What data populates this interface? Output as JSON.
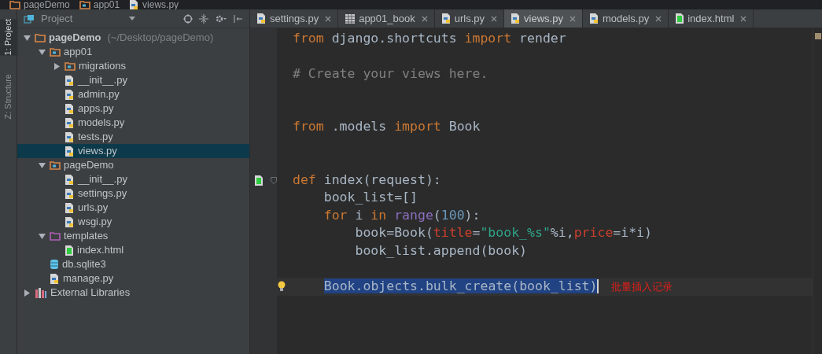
{
  "breadcrumbs": [
    {
      "label": "pageDemo",
      "kind": "folder"
    },
    {
      "label": "app01",
      "kind": "module"
    },
    {
      "label": "views.py",
      "kind": "python"
    }
  ],
  "tool_strip": [
    {
      "label": "1: Project",
      "selected": true
    },
    {
      "label": "Z: Structure",
      "selected": false
    }
  ],
  "project_panel": {
    "title": "Project",
    "tree": [
      {
        "label": "pageDemo",
        "path": "(~/Desktop/pageDemo)",
        "kind": "folder",
        "expanded": true,
        "selected": false,
        "children": [
          {
            "label": "app01",
            "kind": "module",
            "expanded": true,
            "selected": false,
            "children": [
              {
                "label": "migrations",
                "kind": "module",
                "expanded": false,
                "selected": false
              },
              {
                "label": "__init__.py",
                "kind": "python",
                "selected": false
              },
              {
                "label": "admin.py",
                "kind": "python",
                "selected": false
              },
              {
                "label": "apps.py",
                "kind": "python",
                "selected": false
              },
              {
                "label": "models.py",
                "kind": "python",
                "selected": false
              },
              {
                "label": "tests.py",
                "kind": "python",
                "selected": false
              },
              {
                "label": "views.py",
                "kind": "python",
                "selected": true
              }
            ]
          },
          {
            "label": "pageDemo",
            "kind": "module",
            "expanded": true,
            "selected": false,
            "children": [
              {
                "label": "__init__.py",
                "kind": "python",
                "selected": false
              },
              {
                "label": "settings.py",
                "kind": "python",
                "selected": false
              },
              {
                "label": "urls.py",
                "kind": "python",
                "selected": false
              },
              {
                "label": "wsgi.py",
                "kind": "python",
                "selected": false
              }
            ]
          },
          {
            "label": "templates",
            "kind": "template",
            "expanded": true,
            "selected": false,
            "children": [
              {
                "label": "index.html",
                "kind": "html",
                "selected": false
              }
            ]
          },
          {
            "label": "db.sqlite3",
            "kind": "db",
            "selected": false
          },
          {
            "label": "manage.py",
            "kind": "python",
            "selected": false
          }
        ]
      },
      {
        "label": "External Libraries",
        "kind": "libraries",
        "expanded": false,
        "selected": false
      }
    ]
  },
  "tabs": [
    {
      "label": "settings.py",
      "kind": "python",
      "selected": false
    },
    {
      "label": "app01_book",
      "kind": "table",
      "selected": false
    },
    {
      "label": "urls.py",
      "kind": "python",
      "selected": false
    },
    {
      "label": "views.py",
      "kind": "python",
      "selected": true
    },
    {
      "label": "models.py",
      "kind": "python",
      "selected": false
    },
    {
      "label": "index.html",
      "kind": "html",
      "selected": false
    }
  ],
  "code": [
    {
      "kind": "code",
      "tokens": [
        {
          "t": "from",
          "kind": "keyword"
        },
        {
          "t": " django.shortcuts ",
          "kind": "plain"
        },
        {
          "t": "import",
          "kind": "keyword"
        },
        {
          "t": " render",
          "kind": "plain"
        }
      ]
    },
    {
      "kind": "blank"
    },
    {
      "kind": "code",
      "tokens": [
        {
          "t": "# Create your views here.",
          "kind": "comment"
        }
      ]
    },
    {
      "kind": "blank"
    },
    {
      "kind": "blank"
    },
    {
      "kind": "code",
      "tokens": [
        {
          "t": "from",
          "kind": "keyword"
        },
        {
          "t": " .models ",
          "kind": "plain"
        },
        {
          "t": "import",
          "kind": "keyword"
        },
        {
          "t": " Book",
          "kind": "plain"
        }
      ]
    },
    {
      "kind": "blank"
    },
    {
      "kind": "blank"
    },
    {
      "kind": "definition",
      "tokens": [
        {
          "t": "def",
          "kind": "keyword"
        },
        {
          "t": " index(request):",
          "kind": "plain"
        }
      ]
    },
    {
      "kind": "code",
      "tokens": [
        {
          "t": "    book_list=[]",
          "kind": "plain"
        }
      ]
    },
    {
      "kind": "code",
      "tokens": [
        {
          "t": "    for",
          "kind": "keyword"
        },
        {
          "t": " i ",
          "kind": "plain"
        },
        {
          "t": "in",
          "kind": "keyword"
        },
        {
          "t": " range",
          "kind": "builtin"
        },
        {
          "t": "(",
          "kind": "plain"
        },
        {
          "t": "100",
          "kind": "number"
        },
        {
          "t": "):",
          "kind": "plain"
        }
      ]
    },
    {
      "kind": "code",
      "tokens": [
        {
          "t": "        book=Book(",
          "kind": "plain"
        },
        {
          "t": "title",
          "kind": "param"
        },
        {
          "t": "=",
          "kind": "plain"
        },
        {
          "t": "\"book_%s\"",
          "kind": "string"
        },
        {
          "t": "%i,",
          "kind": "plain"
        },
        {
          "t": "price",
          "kind": "param"
        },
        {
          "t": "=i*i)",
          "kind": "plain"
        }
      ]
    },
    {
      "kind": "code",
      "tokens": [
        {
          "t": "        book_list.append(book)",
          "kind": "plain"
        }
      ]
    },
    {
      "kind": "blank"
    },
    {
      "kind": "current",
      "tokens": [
        {
          "t": "Book.objects.bulk_create(book_list)",
          "kind": "selected"
        }
      ],
      "note": "批量插入记录"
    }
  ]
}
